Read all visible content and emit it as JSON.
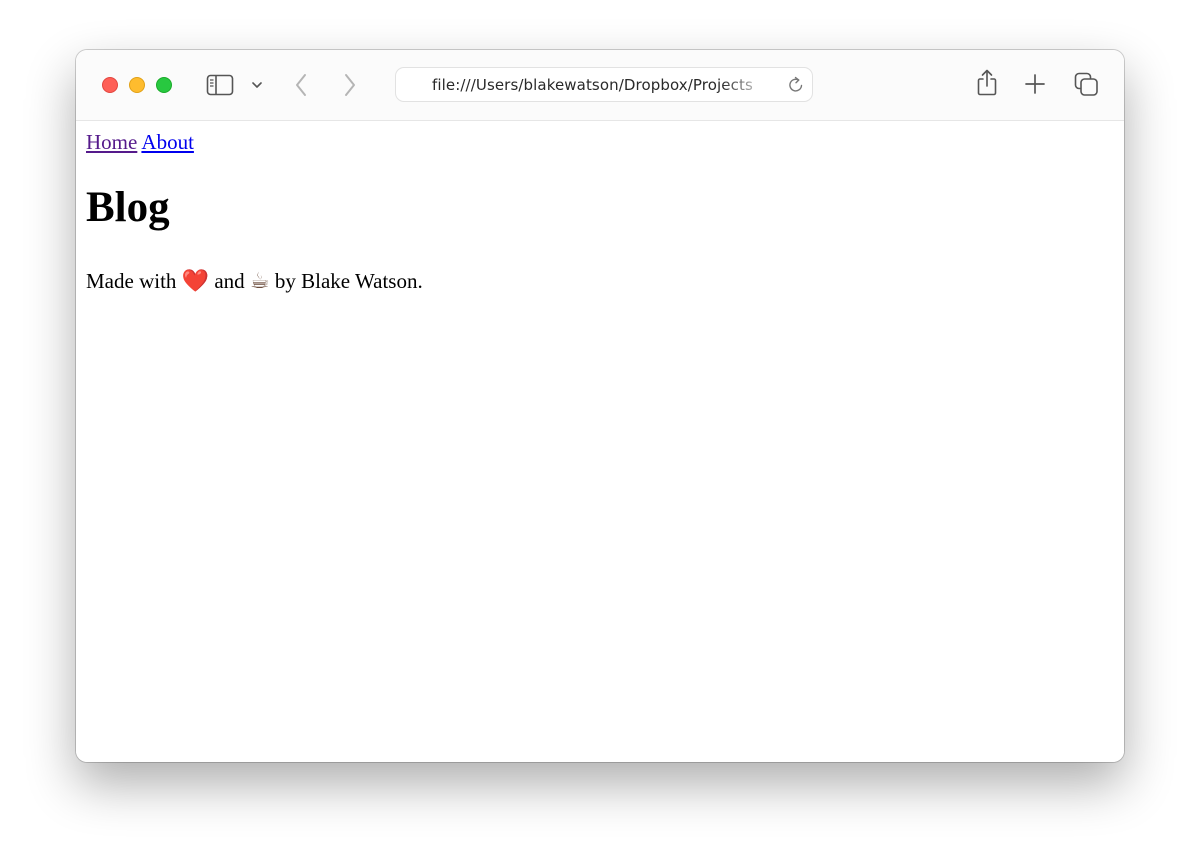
{
  "browser": {
    "url": "file:///Users/blakewatson/Dropbox/Projects",
    "toolbar_icons": [
      "sidebar-icon",
      "chevron-down-icon",
      "back-icon",
      "forward-icon",
      "reload-icon",
      "share-icon",
      "new-tab-icon",
      "tab-overview-icon"
    ]
  },
  "page": {
    "nav": [
      {
        "label": "Home",
        "state": "visited"
      },
      {
        "label": "About",
        "state": "link"
      }
    ],
    "heading": "Blog",
    "footer": {
      "prefix": "Made with",
      "heart_emoji": "❤️",
      "middle": "and",
      "coffee_emoji": "☕",
      "suffix": "by Blake Watson."
    }
  },
  "colors": {
    "link_visited": "#551a8b",
    "link_unvisited": "#0000ee",
    "traffic_red": "#fe5f57",
    "traffic_yellow": "#febc2e",
    "traffic_green": "#28c840"
  }
}
